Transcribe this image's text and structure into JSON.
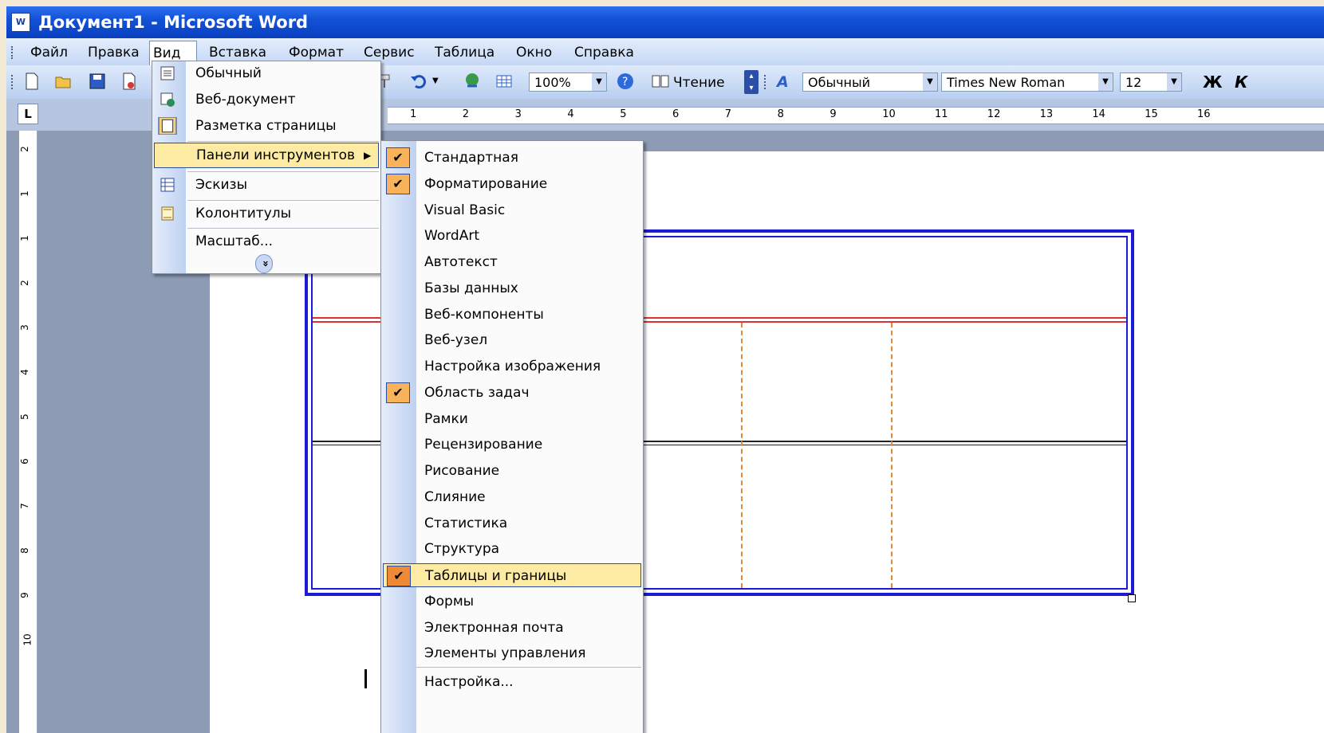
{
  "window": {
    "title": "Документ1 - Microsoft Word"
  },
  "menubar": {
    "items": [
      "Файл",
      "Правка",
      "Вид",
      "Вставка",
      "Формат",
      "Сервис",
      "Таблица",
      "Окно",
      "Справка"
    ],
    "active": "Вид"
  },
  "toolbar": {
    "zoom": "100%",
    "reading_label": "Чтение",
    "style": "Обычный",
    "font": "Times New Roman",
    "size": "12",
    "bold_label": "Ж",
    "italic_label": "К"
  },
  "ruler": {
    "tab_selector": "L",
    "h_numbers": [
      "1",
      "2",
      "3",
      "4",
      "5",
      "6",
      "7",
      "8",
      "9",
      "10",
      "11",
      "12",
      "13",
      "14",
      "15",
      "16"
    ],
    "v_numbers": [
      "2",
      "1",
      "1",
      "2",
      "3",
      "4",
      "5",
      "6",
      "7",
      "8",
      "9",
      "10"
    ]
  },
  "view_menu": {
    "items": [
      {
        "label": "Обычный",
        "icon": "normal-view-icon"
      },
      {
        "label": "Веб-документ",
        "icon": "web-layout-icon"
      },
      {
        "label": "Разметка страницы",
        "icon": "print-layout-icon"
      },
      {
        "label": "Панели инструментов",
        "icon": "",
        "submenu": true,
        "highlighted": true
      },
      {
        "label": "Эскизы",
        "icon": "thumbnails-icon"
      },
      {
        "label": "Колонтитулы",
        "icon": "header-footer-icon"
      },
      {
        "label": "Масштаб...",
        "icon": ""
      }
    ],
    "expand_label": "»"
  },
  "toolbars_submenu": {
    "items": [
      {
        "label": "Стандартная",
        "checked": true
      },
      {
        "label": "Форматирование",
        "checked": true
      },
      {
        "label": "Visual Basic",
        "checked": false
      },
      {
        "label": "WordArt",
        "checked": false
      },
      {
        "label": "Автотекст",
        "checked": false
      },
      {
        "label": "Базы данных",
        "checked": false
      },
      {
        "label": "Веб-компоненты",
        "checked": false
      },
      {
        "label": "Веб-узел",
        "checked": false
      },
      {
        "label": "Настройка изображения",
        "checked": false
      },
      {
        "label": "Область задач",
        "checked": true
      },
      {
        "label": "Рамки",
        "checked": false
      },
      {
        "label": "Рецензирование",
        "checked": false
      },
      {
        "label": "Рисование",
        "checked": false
      },
      {
        "label": "Слияние",
        "checked": false
      },
      {
        "label": "Статистика",
        "checked": false
      },
      {
        "label": "Структура",
        "checked": false
      },
      {
        "label": "Таблицы и границы",
        "checked": true,
        "highlighted": true
      },
      {
        "label": "Формы",
        "checked": false
      },
      {
        "label": "Электронная почта",
        "checked": false
      },
      {
        "label": "Элементы управления",
        "checked": false
      },
      {
        "label": "Настройка...",
        "checked": false
      }
    ]
  },
  "colors": {
    "title_bar": "#0a3fbf",
    "highlight": "#fdeaa3",
    "check_bg": "#f8b25a",
    "table_border": "#1b1bd6",
    "table_red": "#e03030",
    "dashed_orange": "#e08a3a"
  }
}
